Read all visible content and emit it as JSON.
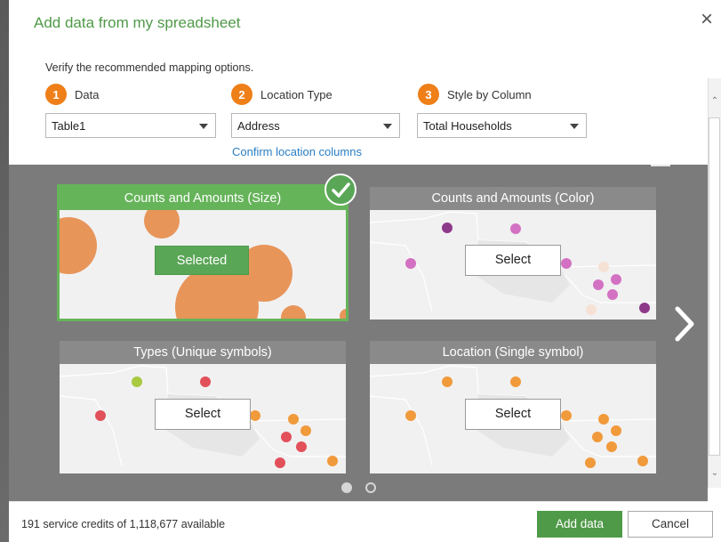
{
  "dialog": {
    "title": "Add data from my spreadsheet",
    "close_icon": "×",
    "instruction": "Verify the recommended mapping options."
  },
  "steps": [
    {
      "number": "1",
      "label": "Data",
      "selected_value": "Table1"
    },
    {
      "number": "2",
      "label": "Location Type",
      "selected_value": "Address"
    },
    {
      "number": "3",
      "label": "Style by Column",
      "selected_value": "Total Households"
    }
  ],
  "confirm_link": "Confirm location columns",
  "cards": [
    {
      "title": "Counts and Amounts (Size)",
      "button": "Selected",
      "selected": true
    },
    {
      "title": "Counts and Amounts (Color)",
      "button": "Select",
      "selected": false
    },
    {
      "title": "Types (Unique symbols)",
      "button": "Select",
      "selected": false
    },
    {
      "title": "Location (Single symbol)",
      "button": "Select",
      "selected": false
    }
  ],
  "pagination": {
    "pages": 2,
    "current": 1
  },
  "footer": {
    "credits": "191 service credits of 1,118,677 available",
    "primary_button": "Add data",
    "secondary_button": "Cancel"
  },
  "icons": {
    "close": "close-icon",
    "step_badge": "numbered-badge-icon",
    "dropdown": "chevron-down-icon",
    "selected_check": "check-icon",
    "next": "chevron-right-icon"
  },
  "colors": {
    "accent_green": "#4f9a48",
    "selected_green": "#66b45a",
    "step_orange": "#ee7f19",
    "link_blue": "#2a7ec4",
    "gallery_bg": "#7b7b7b",
    "bubble_orange": "#e8955a",
    "point_purple": "#8e3a8a",
    "point_magenta": "#d371c2",
    "point_red": "#e2505a",
    "point_lime": "#a8c940",
    "point_orange": "#f19a3b"
  }
}
